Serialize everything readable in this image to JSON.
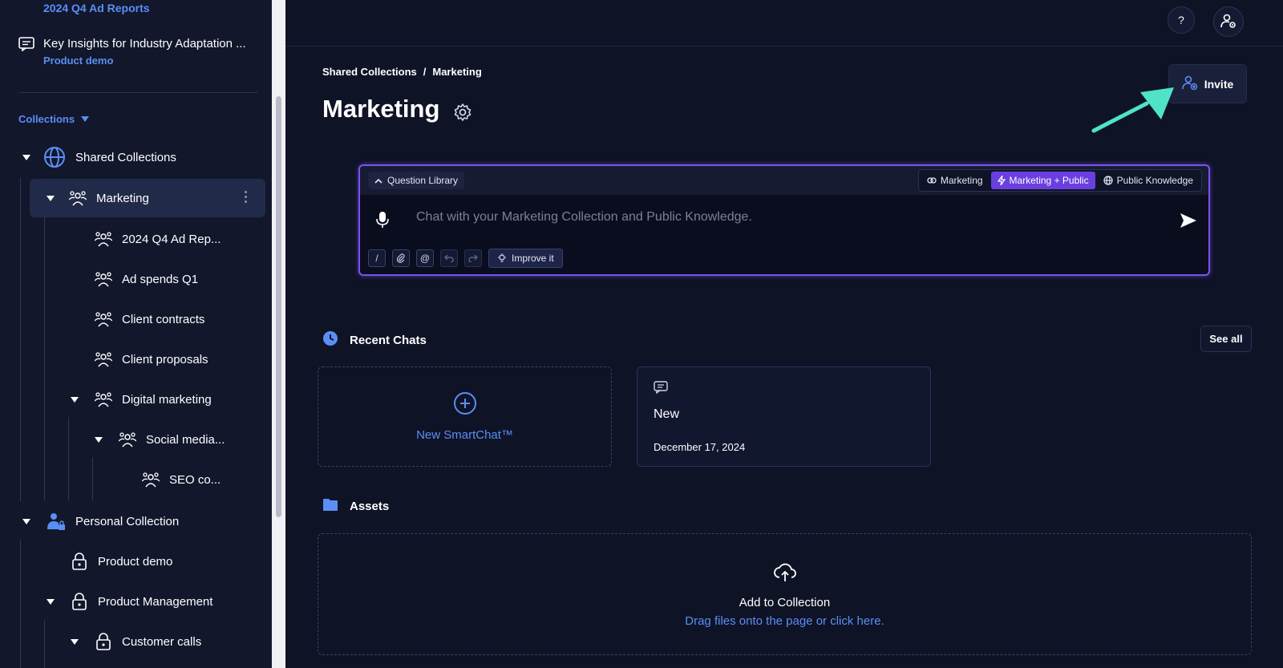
{
  "sidebar": {
    "recent_chat_top": "2024 Q4 Ad Reports",
    "recent_chat_item": {
      "title": "Key Insights for Industry Adaptation ...",
      "collection": "Product demo"
    },
    "collections_label": "Collections",
    "tree": [
      {
        "label": "Shared Collections",
        "icon": "globe-icon"
      },
      {
        "label": "Marketing",
        "icon": "group-icon",
        "selected": true
      },
      {
        "label": "2024 Q4 Ad Rep...",
        "icon": "group-icon"
      },
      {
        "label": "Ad spends Q1",
        "icon": "group-icon"
      },
      {
        "label": "Client contracts",
        "icon": "group-icon"
      },
      {
        "label": "Client proposals",
        "icon": "group-icon"
      },
      {
        "label": "Digital marketing",
        "icon": "group-icon"
      },
      {
        "label": "Social media...",
        "icon": "group-icon"
      },
      {
        "label": "SEO co...",
        "icon": "group-icon"
      },
      {
        "label": "Personal Collection",
        "icon": "user-lock-icon"
      },
      {
        "label": "Product demo",
        "icon": "lock-icon"
      },
      {
        "label": "Product Management",
        "icon": "lock-icon"
      },
      {
        "label": "Customer calls",
        "icon": "lock-icon"
      }
    ]
  },
  "header": {
    "help_label": "?",
    "breadcrumb": [
      "Shared Collections",
      "/",
      "Marketing"
    ],
    "title": "Marketing",
    "invite_label": "Invite"
  },
  "chat": {
    "question_library": "Question Library",
    "scopes": [
      "Marketing",
      "Marketing + Public",
      "Public Knowledge"
    ],
    "active_scope": "Marketing + Public",
    "placeholder": "Chat with your Marketing Collection and Public Knowledge.",
    "tools": [
      "/",
      "attach",
      "@",
      "undo",
      "redo"
    ],
    "improve_label": "Improve it"
  },
  "recent_chats": {
    "title": "Recent Chats",
    "see_all": "See all",
    "new_label": "New SmartChat™",
    "items": [
      {
        "title": "New",
        "date": "December 17, 2024"
      }
    ]
  },
  "assets": {
    "title": "Assets",
    "drop_title": "Add to Collection",
    "drop_sub": "Drag files onto the page or click here."
  },
  "colors": {
    "accent": "#5b8ef5",
    "purple": "#7a52f0",
    "arrow": "#4fe3c8",
    "bg": "#0f1326"
  }
}
